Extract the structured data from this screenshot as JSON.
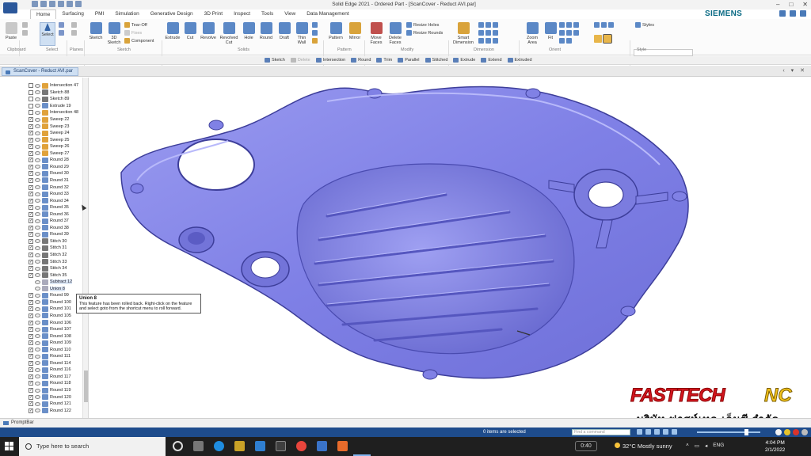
{
  "window": {
    "title": "Solid Edge 2021 - Ordered Part - [ScanCover - Reduct AVI.par]",
    "brand": "SIEMENS",
    "controls": [
      "–",
      "□",
      "✕"
    ]
  },
  "tabs": [
    "Home",
    "Surfacing",
    "PMI",
    "Simulation",
    "Generative Design",
    "3D Print",
    "Inspect",
    "Tools",
    "View",
    "Data Management"
  ],
  "active_tab": "Home",
  "ribbon": {
    "clipboard": {
      "paste": "Paste",
      "label": "Clipboard"
    },
    "select": {
      "select": "Select",
      "label": "Select"
    },
    "planes": {
      "label": "Planes"
    },
    "sketch": {
      "sketch": "Sketch",
      "sketch3d": "3D Sketch",
      "tearoff": "Tear-Off",
      "fixes": "Fixes",
      "component": "Component",
      "label": "Sketch"
    },
    "solids": {
      "extrude": "Extrude",
      "cut": "Cut",
      "revolve": "Revolve",
      "revolved_cut": "Revolved Cut",
      "hole": "Hole",
      "round": "Round",
      "draft": "Draft",
      "thin_wall": "Thin Wall",
      "label": "Solids"
    },
    "pattern": {
      "pattern": "Pattern",
      "mirror": "Mirror",
      "label": "Pattern"
    },
    "modify": {
      "move_faces": "Move Faces",
      "delete_faces": "Delete Faces",
      "resize_holes": "Resize Holes",
      "resize_rounds": "Resize Rounds",
      "label": "Modify"
    },
    "dimension": {
      "smart": "Smart Dimension",
      "label": "Dimension"
    },
    "orient": {
      "zoom_area": "Zoom Area",
      "fit": "Fit",
      "label": "Orient"
    },
    "style": {
      "styles": "Styles",
      "label": "Style"
    }
  },
  "command_bar": [
    {
      "label": "Sketch",
      "enabled": true
    },
    {
      "label": "Delete",
      "enabled": false
    },
    {
      "label": "Intersection",
      "enabled": true
    },
    {
      "label": "Round",
      "enabled": true
    },
    {
      "label": "Trim",
      "enabled": true
    },
    {
      "label": "Parallel",
      "enabled": true
    },
    {
      "label": "Stitched",
      "enabled": true
    },
    {
      "label": "Extrude",
      "enabled": true
    },
    {
      "label": "Extend",
      "enabled": true
    },
    {
      "label": "Extruded",
      "enabled": true
    }
  ],
  "document_tab": "ScanCover - Reduct AVI.par",
  "pathfinder": [
    {
      "label": "Intersection 47",
      "checked": false
    },
    {
      "label": "Sketch 88",
      "checked": false
    },
    {
      "label": "Sketch 89",
      "checked": false
    },
    {
      "label": "Extrude 19",
      "checked": false
    },
    {
      "label": "Intersection 48",
      "checked": false
    },
    {
      "label": "Sweep 22",
      "checked": true
    },
    {
      "label": "Sweep 23",
      "checked": true
    },
    {
      "label": "Sweep 24",
      "checked": true
    },
    {
      "label": "Sweep 25",
      "checked": true
    },
    {
      "label": "Sweep 26",
      "checked": true
    },
    {
      "label": "Sweep 27",
      "checked": true
    },
    {
      "label": "Round 28",
      "checked": true
    },
    {
      "label": "Round 29",
      "checked": true
    },
    {
      "label": "Round 30",
      "checked": true
    },
    {
      "label": "Round 31",
      "checked": true
    },
    {
      "label": "Round 32",
      "checked": true
    },
    {
      "label": "Round 33",
      "checked": true
    },
    {
      "label": "Round 34",
      "checked": true
    },
    {
      "label": "Round 35",
      "checked": true
    },
    {
      "label": "Round 36",
      "checked": true
    },
    {
      "label": "Round 37",
      "checked": true
    },
    {
      "label": "Round 38",
      "checked": true
    },
    {
      "label": "Round 39",
      "checked": true
    },
    {
      "label": "Stitch 30",
      "checked": true
    },
    {
      "label": "Stitch 31",
      "checked": true
    },
    {
      "label": "Stitch 32",
      "checked": true
    },
    {
      "label": "Stitch 33",
      "checked": true
    },
    {
      "label": "Stitch 34",
      "checked": true
    },
    {
      "label": "Stitch 35",
      "checked": true
    },
    {
      "label": "Subtract 12",
      "checked": null
    },
    {
      "label": "Union 8",
      "checked": null
    },
    {
      "label": "Round 99",
      "checked": true
    },
    {
      "label": "Round 100",
      "checked": true
    },
    {
      "label": "Round 101",
      "checked": true
    },
    {
      "label": "Round 105",
      "checked": true
    },
    {
      "label": "Round 106",
      "checked": true
    },
    {
      "label": "Round 107",
      "checked": true
    },
    {
      "label": "Round 108",
      "checked": true
    },
    {
      "label": "Round 109",
      "checked": true
    },
    {
      "label": "Round 110",
      "checked": true
    },
    {
      "label": "Round 111",
      "checked": true
    },
    {
      "label": "Round 114",
      "checked": true
    },
    {
      "label": "Round 116",
      "checked": true
    },
    {
      "label": "Round 117",
      "checked": true
    },
    {
      "label": "Round 118",
      "checked": true
    },
    {
      "label": "Round 119",
      "checked": true
    },
    {
      "label": "Round 120",
      "checked": true
    },
    {
      "label": "Round 121",
      "checked": true
    },
    {
      "label": "Round 122",
      "checked": true
    }
  ],
  "tooltip": {
    "title": "Union 8",
    "line1": "This feature has been rolled back. Right-click on the feature",
    "line2": "and select goto from the shortcut menu to roll forward."
  },
  "watermark": {
    "brand": "FASTTECH",
    "suffix": "NC",
    "thai": "บริษัท ฟาสท์เทค เอ็นซี จำกัด"
  },
  "prompt_bar": "PromptBar",
  "status": {
    "message": "0 items are selected",
    "search_placeholder": "Find a command"
  },
  "taskbar": {
    "search_placeholder": "Type here to search",
    "recording": "0:40",
    "weather": "32°C  Mostly sunny",
    "language": "ENG",
    "time": "4:04 PM",
    "date": "2/1/2022"
  },
  "colors": {
    "model_fill": "#7f80e6",
    "model_dark": "#4a4bb0",
    "accent": "#1e4c8c",
    "siemens": "#0a6a84"
  }
}
